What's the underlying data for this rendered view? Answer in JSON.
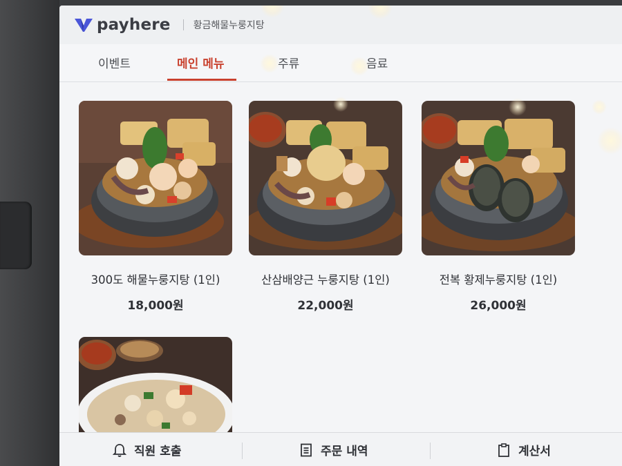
{
  "header": {
    "brand": "payhere",
    "store_name": "황금해물누룽지탕"
  },
  "tabs": [
    {
      "label": "이벤트",
      "active": false
    },
    {
      "label": "메인 메뉴",
      "active": true
    },
    {
      "label": "주류",
      "active": false
    },
    {
      "label": "음료",
      "active": false
    }
  ],
  "menu_items": [
    {
      "name": "300도 해물누룽지탕 (1인)",
      "price": "18,000원"
    },
    {
      "name": "산삼배양근 누룽지탕 (1인)",
      "price": "22,000원"
    },
    {
      "name": "전복 황제누룽지탕 (1인)",
      "price": "26,000원"
    },
    {
      "name": "",
      "price": ""
    }
  ],
  "bottom_bar": {
    "call_staff": "직원 호출",
    "order_history": "주문 내역",
    "bill": "계산서"
  },
  "colors": {
    "accent": "#c9412e",
    "brand": "#4a56d8"
  },
  "icons": [
    "payhere-logo-icon",
    "bell-icon",
    "receipt-list-icon",
    "clipboard-icon"
  ]
}
